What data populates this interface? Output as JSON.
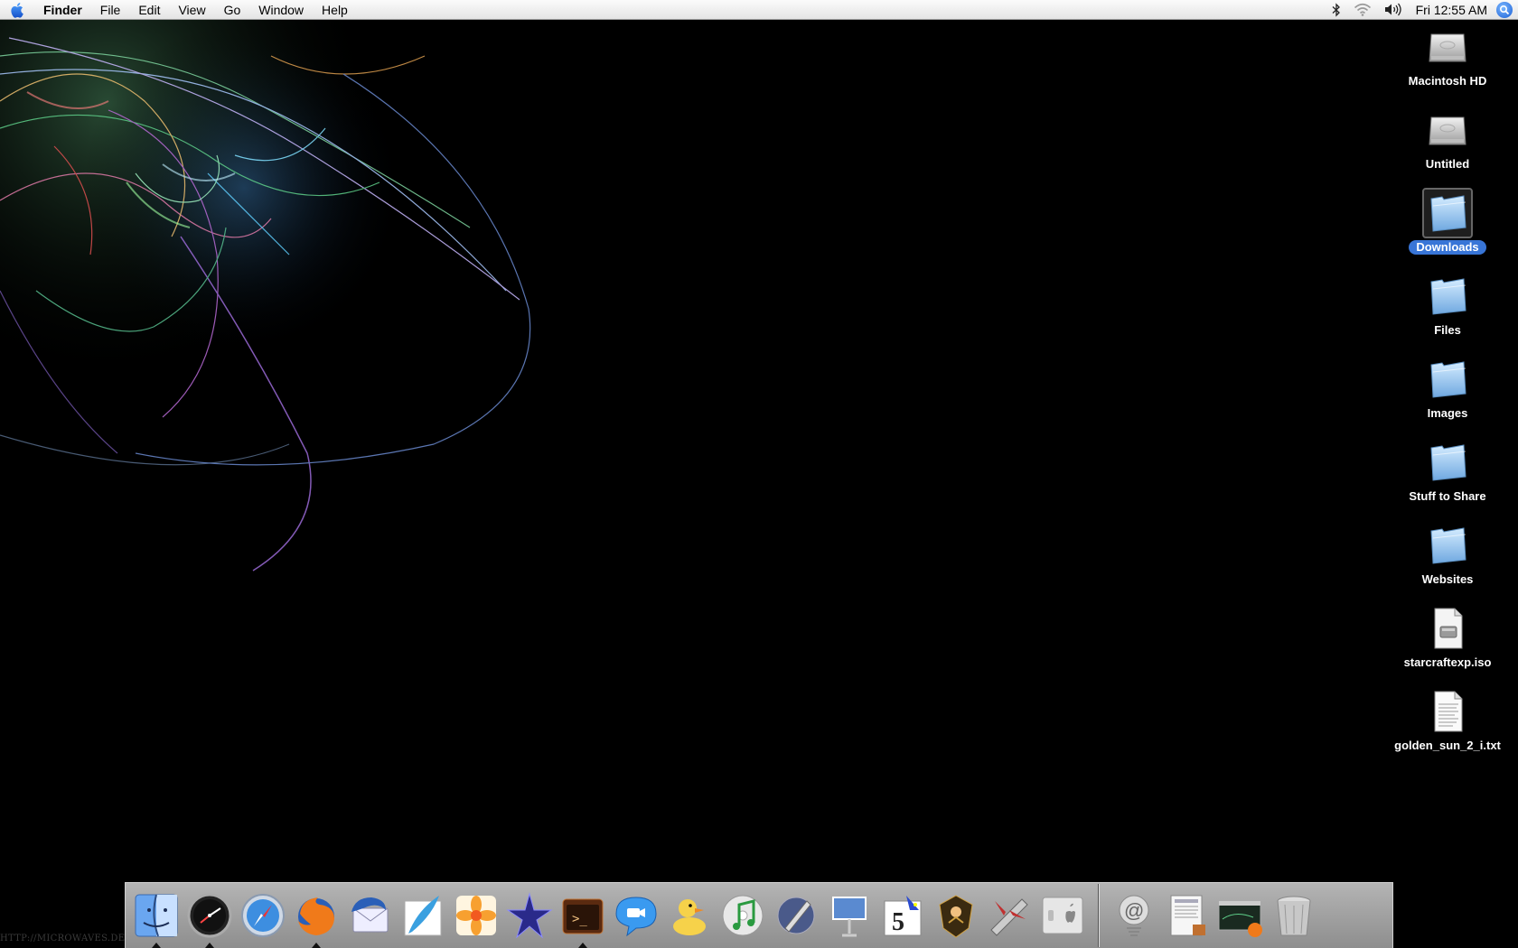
{
  "menubar": {
    "apple_icon": "apple-logo-icon",
    "app_name": "Finder",
    "menus": [
      "File",
      "Edit",
      "View",
      "Go",
      "Window",
      "Help"
    ],
    "status_icons": [
      "bluetooth-icon",
      "wifi-icon",
      "volume-icon"
    ],
    "clock": "Fri 12:55 AM",
    "spotlight_icon": "spotlight-search-icon"
  },
  "wallpaper": {
    "credit": "HTTP://MICROWAVES.DEVIANTART.COM"
  },
  "desktop_icons": [
    {
      "label": "Macintosh HD",
      "icon": "hard-drive-icon",
      "selected": false
    },
    {
      "label": "Untitled",
      "icon": "hard-drive-icon",
      "selected": false
    },
    {
      "label": "Downloads",
      "icon": "folder-icon",
      "selected": true
    },
    {
      "label": "Files",
      "icon": "folder-icon",
      "selected": false
    },
    {
      "label": "Images",
      "icon": "folder-icon",
      "selected": false
    },
    {
      "label": "Stuff to Share",
      "icon": "folder-icon",
      "selected": false
    },
    {
      "label": "Websites",
      "icon": "folder-icon",
      "selected": false
    },
    {
      "label": "starcraftexp.iso",
      "icon": "disk-image-icon",
      "selected": false
    },
    {
      "label": "golden_sun_2_i.txt",
      "icon": "text-document-icon",
      "selected": false
    }
  ],
  "dock": {
    "apps": [
      {
        "icon": "finder-icon",
        "running": true
      },
      {
        "icon": "dashboard-icon",
        "running": true
      },
      {
        "icon": "safari-icon",
        "running": false
      },
      {
        "icon": "firefox-icon",
        "running": true
      },
      {
        "icon": "thunderbird-icon",
        "running": false
      },
      {
        "icon": "feather-icon",
        "running": false
      },
      {
        "icon": "flower-app-icon",
        "running": false
      },
      {
        "icon": "star-app-icon",
        "running": false
      },
      {
        "icon": "terminal-app-icon",
        "running": true
      },
      {
        "icon": "ichat-icon",
        "running": false
      },
      {
        "icon": "cyberduck-icon",
        "running": false
      },
      {
        "icon": "itunes-icon",
        "running": false
      },
      {
        "icon": "script-editor-icon",
        "running": false
      },
      {
        "icon": "keynote-icon",
        "running": false
      },
      {
        "icon": "calendar-app-icon",
        "running": false
      },
      {
        "icon": "game-warrior-icon",
        "running": false
      },
      {
        "icon": "game-ship-icon",
        "running": false
      },
      {
        "icon": "system-switch-icon",
        "running": false
      }
    ],
    "stacks": [
      {
        "icon": "mail-stack-icon"
      },
      {
        "icon": "documents-stack-icon"
      },
      {
        "icon": "firefox-window-stack-icon"
      },
      {
        "icon": "trash-icon"
      }
    ]
  },
  "colors": {
    "menubar_bg": "#ececec",
    "desktop_bg": "#000000",
    "selection": "#3875d7",
    "dock_bg": "#a0a0a0"
  }
}
